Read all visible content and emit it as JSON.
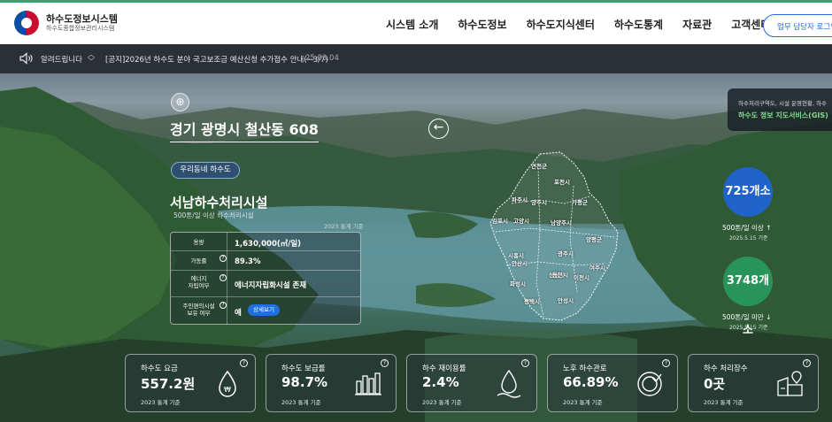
{
  "header": {
    "logo_title": "하수도정보시스템",
    "logo_sub": "하수도종합정보관리시스템",
    "nav": [
      "시스템 소개",
      "하수도정보",
      "하수도지식센터",
      "하수도통계",
      "자료관",
      "고객센터"
    ],
    "login_label": "업무 담당자 로그인"
  },
  "notice": {
    "label": "알려드립니다",
    "message": "[공지]2026년 하수도 분야 국고보조금 예산신청 추가접수 안내(~3/7)",
    "date": "25.03.04"
  },
  "location": {
    "title": "경기 광명시 철산동 608"
  },
  "facility": {
    "pill": "우리동네 하수도",
    "name": "서남하수처리시설",
    "capacity_note": "500톤/일 이상 하수처리시설",
    "year_note": "2023 통계 기준",
    "rows": [
      {
        "key": "용량",
        "value": "1,630,000(㎥/일)"
      },
      {
        "key": "가동률",
        "value": "89.3%"
      },
      {
        "key": "에너지\n자립여부",
        "value": "에너지자립화시설 존재"
      },
      {
        "key": "주민편의시설\n보유 여부",
        "value": "예"
      }
    ],
    "detail_label": "상세보기"
  },
  "map": {
    "regions": [
      "연천군",
      "포천시",
      "파주시",
      "양주시",
      "가평군",
      "김포시",
      "고양시",
      "남양주시",
      "양평군",
      "광주시",
      "시흥시",
      "안산시",
      "성남시",
      "여주시",
      "화성시",
      "용인시",
      "이천시",
      "평택시",
      "안성시"
    ]
  },
  "gis": {
    "desc": "하수처리구역도, 시설 운영현황, 하수",
    "link": "하수도 정보 지도서비스(GIS)"
  },
  "summary": [
    {
      "value": "725개소",
      "caption": "500톤/일 이상 ↑",
      "date": "2025.5.15 기준",
      "color": "#1f63c8"
    },
    {
      "value": "3748개소",
      "caption": "500톤/일 미만 ↓",
      "date": "2025.5.15 기준",
      "color": "#28945a"
    }
  ],
  "cards": [
    {
      "title": "하수도 요금",
      "value": "557.2원",
      "year": "2023 통계 기준",
      "icon": "water-drop-won-icon"
    },
    {
      "title": "하수도 보급률",
      "value": "98.7%",
      "year": "2023 통계 기준",
      "icon": "bar-chart-icon"
    },
    {
      "title": "하수 재이용률",
      "value": "2.4%",
      "year": "2023 통계 기준",
      "icon": "recycle-drop-icon"
    },
    {
      "title": "노후 하수관로",
      "value": "66.89%",
      "year": "2023 통계 기준",
      "icon": "old-pipe-icon"
    },
    {
      "title": "하수 처리장수",
      "value": "0곳",
      "year": "2023 통계 기준",
      "icon": "plant-location-icon"
    }
  ]
}
